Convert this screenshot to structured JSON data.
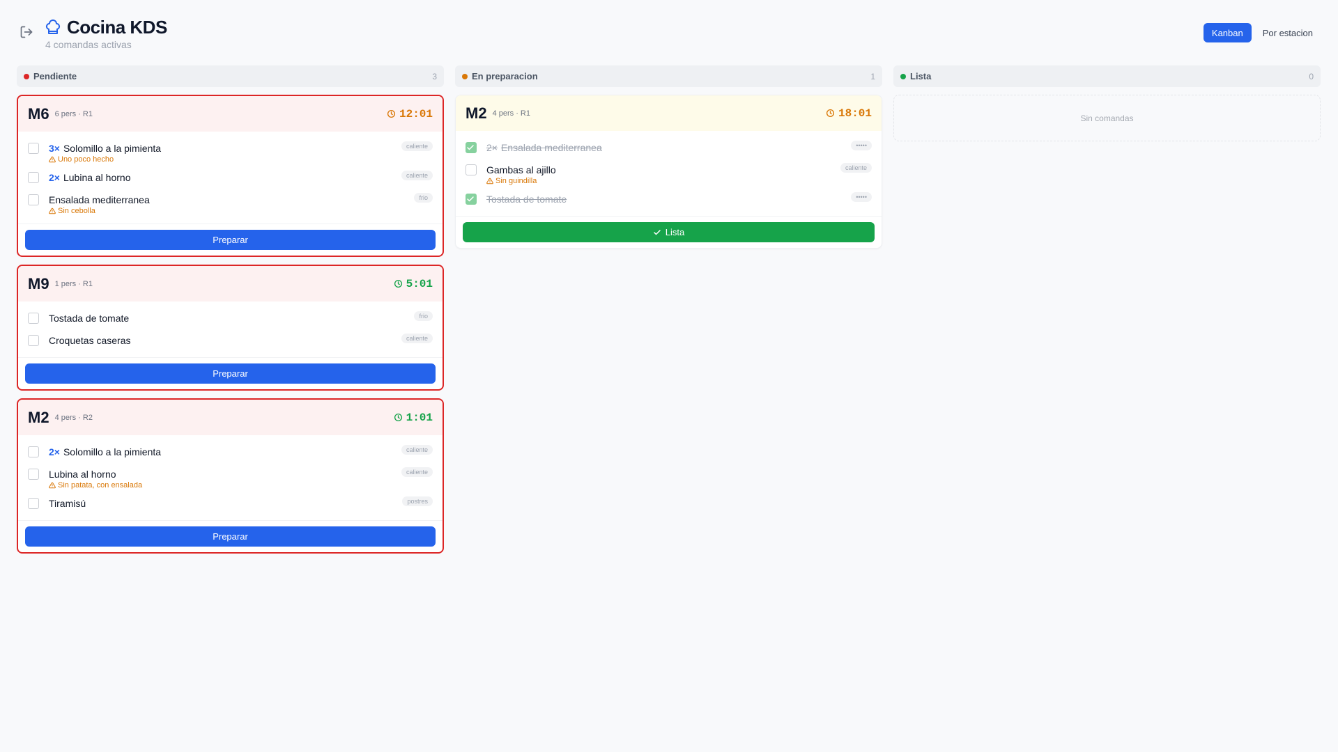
{
  "header": {
    "title": "Cocina KDS",
    "subtitle": "4 comandas activas",
    "views": [
      "Kanban",
      "Por estacion"
    ],
    "active_view": "Kanban"
  },
  "colors": {
    "urgent": "#dc2626",
    "accent": "#2563eb",
    "ready": "#16a34a",
    "warning": "#d97706"
  },
  "columns": [
    {
      "label": "Pendiente",
      "count": "3",
      "dot_color": "#dc2626",
      "empty_label": "",
      "cards": [
        {
          "table": "M6",
          "meta": "6 pers · R1",
          "timer": "12:01",
          "timer_color": "orange",
          "action": "Preparar",
          "items": [
            {
              "qty": "3×",
              "name": "Solomillo a la pimienta",
              "note": "Uno poco hecho",
              "tag": "caliente",
              "done": false
            },
            {
              "qty": "2×",
              "name": "Lubina al horno",
              "note": "",
              "tag": "caliente",
              "done": false
            },
            {
              "qty": "",
              "name": "Ensalada mediterranea",
              "note": "Sin cebolla",
              "tag": "frio",
              "done": false
            }
          ]
        },
        {
          "table": "M9",
          "meta": "1 pers · R1",
          "timer": "5:01",
          "timer_color": "green",
          "action": "Preparar",
          "items": [
            {
              "qty": "",
              "name": "Tostada de tomate",
              "note": "",
              "tag": "frio",
              "done": false
            },
            {
              "qty": "",
              "name": "Croquetas caseras",
              "note": "",
              "tag": "caliente",
              "done": false
            }
          ]
        },
        {
          "table": "M2",
          "meta": "4 pers · R2",
          "timer": "1:01",
          "timer_color": "green",
          "action": "Preparar",
          "items": [
            {
              "qty": "2×",
              "name": "Solomillo a la pimienta",
              "note": "",
              "tag": "caliente",
              "done": false
            },
            {
              "qty": "",
              "name": "Lubina al horno",
              "note": "Sin patata, con ensalada",
              "tag": "caliente",
              "done": false
            },
            {
              "qty": "",
              "name": "Tiramisú",
              "note": "",
              "tag": "postres",
              "done": false
            }
          ]
        }
      ]
    },
    {
      "label": "En preparacion",
      "count": "1",
      "dot_color": "#d97706",
      "empty_label": "",
      "cards": [
        {
          "table": "M2",
          "meta": "4 pers · R1",
          "timer": "18:01",
          "timer_color": "orange",
          "action": "Lista",
          "items": [
            {
              "qty": "2×",
              "name": "Ensalada mediterranea",
              "note": "",
              "tag": "•••••",
              "done": true
            },
            {
              "qty": "",
              "name": "Gambas al ajillo",
              "note": "Sin guindilla",
              "tag": "caliente",
              "done": false
            },
            {
              "qty": "",
              "name": "Tostada de tomate",
              "note": "",
              "tag": "•••••",
              "done": true
            }
          ]
        }
      ]
    },
    {
      "label": "Lista",
      "count": "0",
      "dot_color": "#16a34a",
      "empty_label": "Sin comandas",
      "cards": []
    }
  ]
}
